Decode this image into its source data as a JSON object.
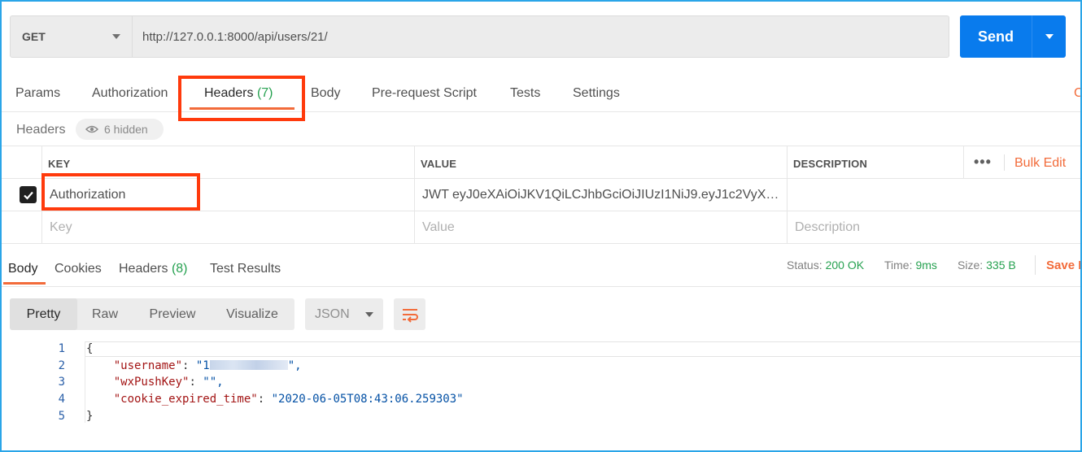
{
  "request": {
    "method": "GET",
    "url": "http://127.0.0.1:8000/api/users/21/",
    "send_label": "Send"
  },
  "request_tabs": [
    {
      "label": "Params"
    },
    {
      "label": "Authorization"
    },
    {
      "label": "Headers",
      "count": "(7)"
    },
    {
      "label": "Body"
    },
    {
      "label": "Pre-request Script"
    },
    {
      "label": "Tests"
    },
    {
      "label": "Settings"
    }
  ],
  "edge_text": "C",
  "headers_section": {
    "title": "Headers",
    "hidden_label": "6 hidden"
  },
  "headers_table": {
    "columns": [
      "KEY",
      "VALUE",
      "DESCRIPTION"
    ],
    "bulk_edit": "Bulk Edit",
    "more_label": "•••",
    "rows": [
      {
        "checked": true,
        "key": "Authorization",
        "value": "JWT eyJ0eXAiOiJKV1QiLCJhbGciOiJIUzI1NiJ9.eyJ1c2VyX2lkIjoy...",
        "description": ""
      }
    ],
    "placeholders": {
      "key": "Key",
      "value": "Value",
      "description": "Description"
    }
  },
  "response_tabs": [
    {
      "label": "Body"
    },
    {
      "label": "Cookies"
    },
    {
      "label": "Headers",
      "count": "(8)"
    },
    {
      "label": "Test Results"
    }
  ],
  "response_status": {
    "status_label": "Status:",
    "status_value": "200 OK",
    "time_label": "Time:",
    "time_value": "9ms",
    "size_label": "Size:",
    "size_value": "335 B",
    "save_label": "Save R"
  },
  "response_view": {
    "modes": [
      "Pretty",
      "Raw",
      "Preview",
      "Visualize"
    ],
    "active_mode": "Pretty",
    "format": "JSON"
  },
  "response_body": {
    "line_numbers": [
      "1",
      "2",
      "3",
      "4",
      "5"
    ],
    "open_brace": "{",
    "close_brace": "}",
    "fields": [
      {
        "key": "\"username\"",
        "value_prefix": "\"1",
        "value_suffix": "\","
      },
      {
        "key": "\"wxPushKey\"",
        "value": "\"\","
      },
      {
        "key": "\"cookie_expired_time\"",
        "value": "\"2020-06-05T08:43:06.259303\""
      }
    ]
  },
  "colors": {
    "accent": "#f26b3a",
    "send": "#097bed",
    "highlight_box": "#ff3a0c",
    "count_green": "#26a150"
  }
}
